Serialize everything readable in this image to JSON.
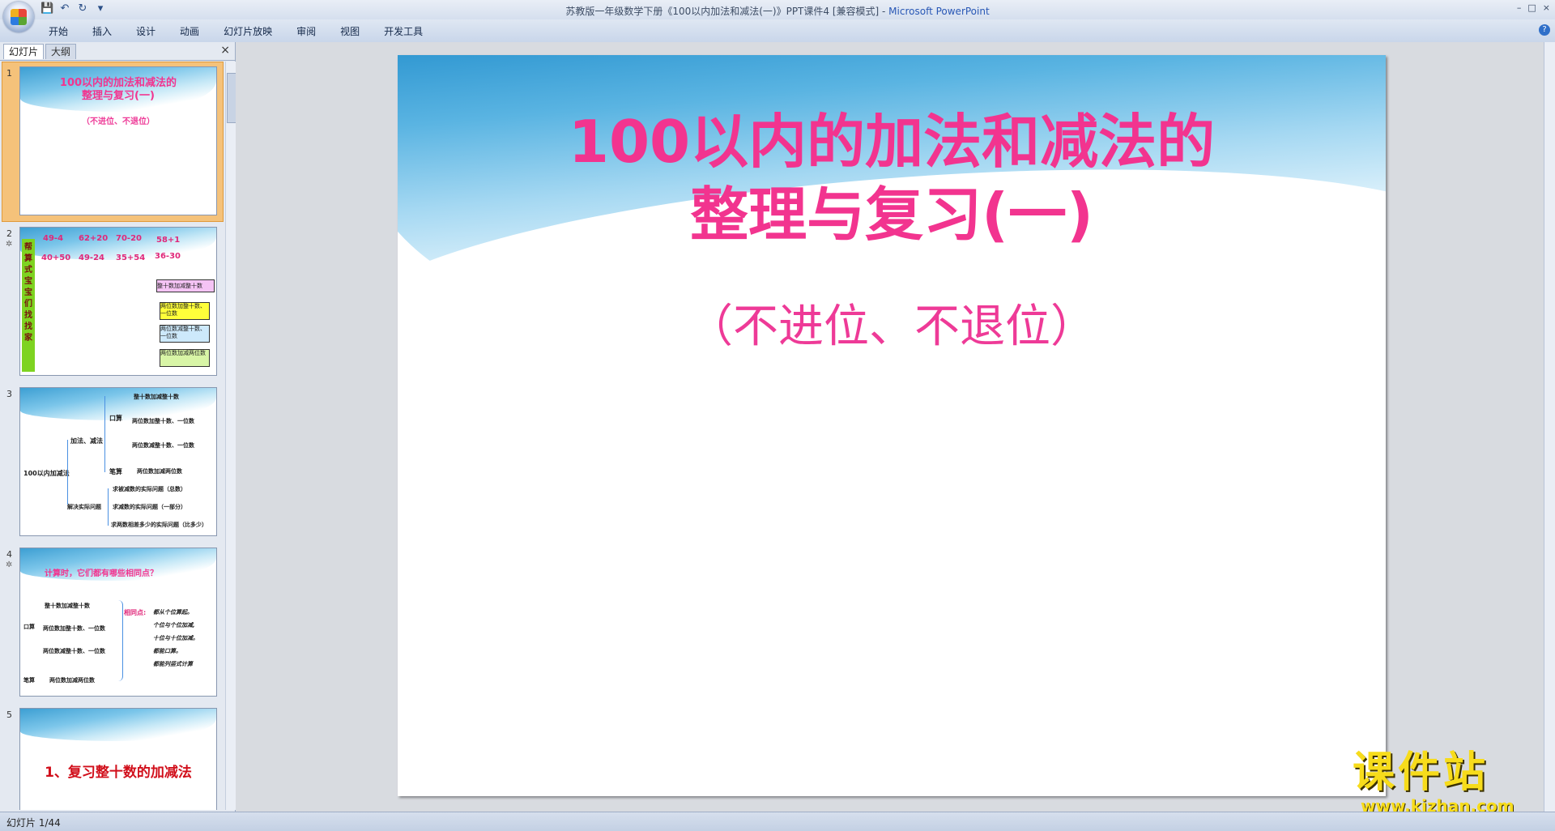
{
  "window": {
    "title": "苏教版一年级数学下册《100以内加法和减法(一)》PPT课件4 [兼容模式] - ",
    "app_name": "Microsoft PowerPoint",
    "controls": [
      "–",
      "□",
      "×"
    ]
  },
  "ribbon": {
    "tabs": [
      "开始",
      "插入",
      "设计",
      "动画",
      "幻灯片放映",
      "审阅",
      "视图",
      "开发工具"
    ]
  },
  "panel": {
    "tab_slides": "幻灯片",
    "tab_outline": "大纲",
    "close": "×"
  },
  "thumbnails": [
    {
      "num": "1",
      "title": "100以内的加法和减法的\n整理与复习(一)",
      "sub": "（不进位、不退位）"
    },
    {
      "num": "2",
      "side": "帮算式宝宝们找找家",
      "exprs": [
        "49-4",
        "62+20",
        "70-20",
        "58+1",
        "40+50",
        "49-24",
        "35+54",
        "36-30"
      ],
      "houses": [
        "整十数加减整十数",
        "两位数加整十数、一位数",
        "两位数减整十数、一位数",
        "两位数加减两位数"
      ]
    },
    {
      "num": "3",
      "root": "100以内加减法",
      "nodes": [
        "加法、减法",
        "口算",
        "笔算",
        "整十数加减整十数",
        "两位数加整十数、一位数",
        "两位数减整十数、一位数",
        "两位数加减两位数",
        "解决实际问题",
        "求被减数的实际问题（总数）",
        "求减数的实际问题（一部分）",
        "求两数相差多少的实际问题（比多少）"
      ]
    },
    {
      "num": "4",
      "title": "计算时，它们都有哪些相同点？",
      "left": [
        "口算",
        "整十数加减整十数",
        "两位数加整十数、一位数",
        "两位数减整十数、一位数",
        "笔算",
        "两位数加减两位数"
      ],
      "same_label": "相同点:",
      "same": [
        "都从个位算起。",
        "个位与个位加减,",
        "十位与十位加减。",
        "都能口算。",
        "都能列竖式计算"
      ]
    },
    {
      "num": "5",
      "title": "1、复习整十数的加减法"
    }
  ],
  "slide": {
    "title_line1": "100以内的加法和减法的",
    "title_line2": "整理与复习(一)",
    "subtitle": "（不进位、不退位）"
  },
  "status": {
    "text": "幻灯片 1/44"
  },
  "watermark": {
    "cn": "课件站",
    "url": "www.kjzhan.com"
  }
}
